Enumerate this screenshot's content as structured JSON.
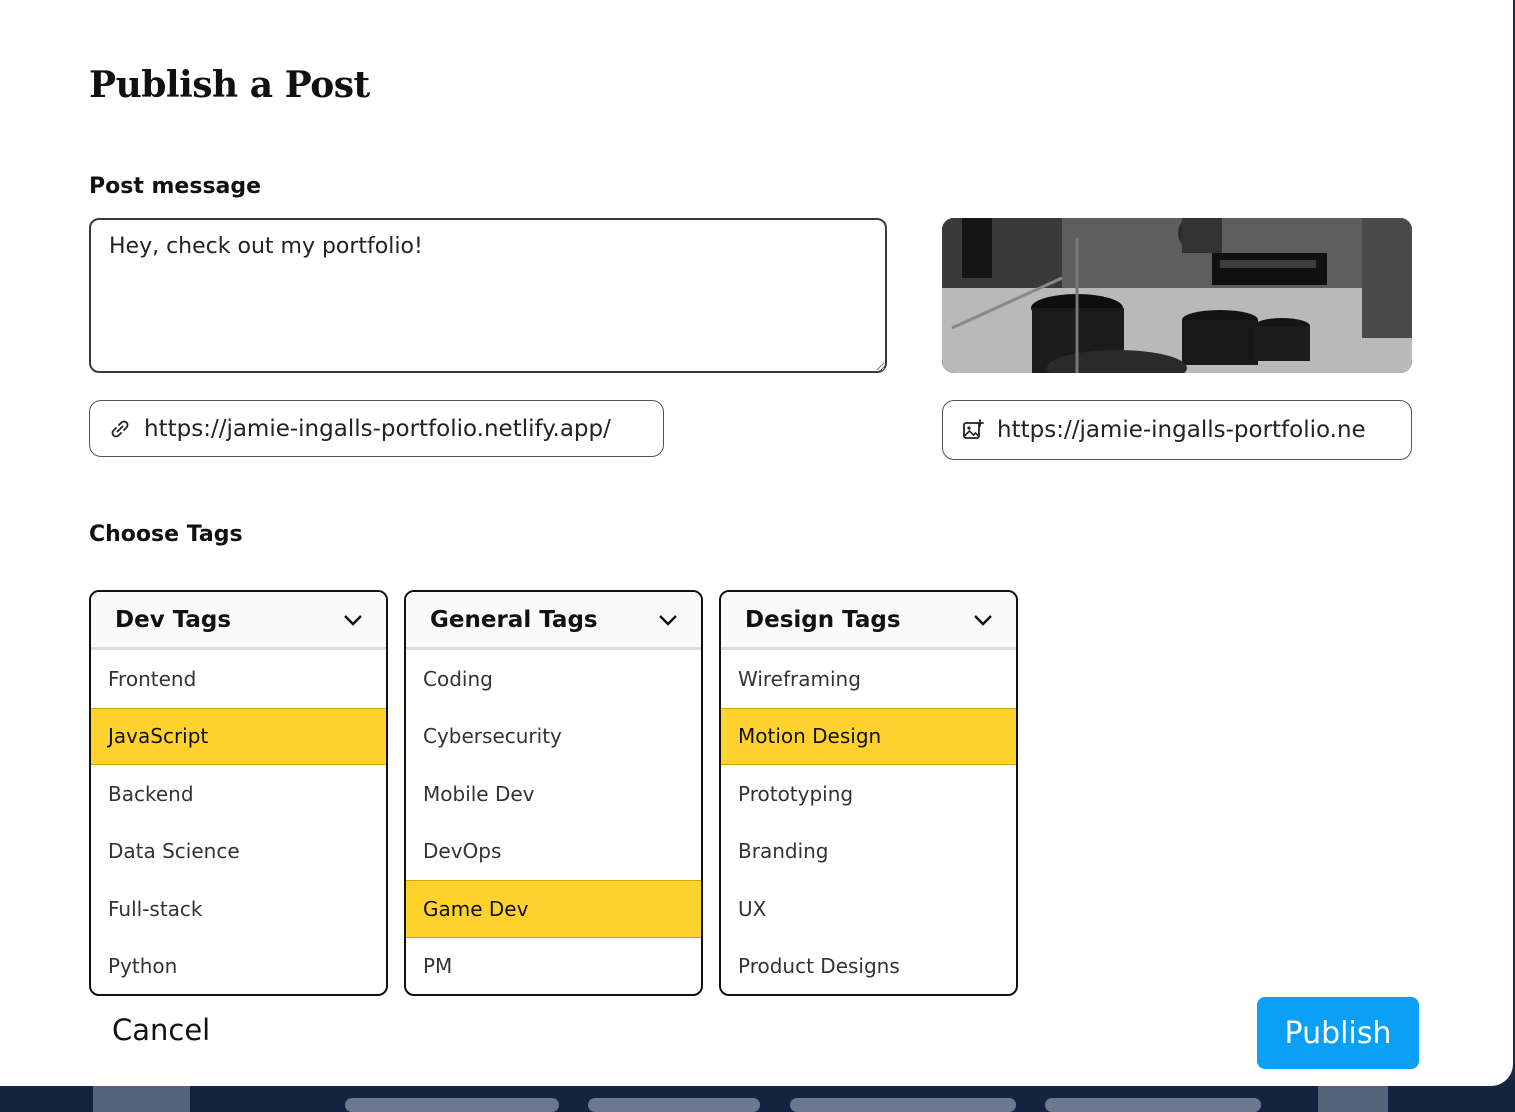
{
  "modal": {
    "title": "Publish a Post",
    "post_message_label": "Post message",
    "post_message_value": "Hey, check out my portfolio!",
    "link_url": "https://jamie-ingalls-portfolio.netlify.app/",
    "image_url": "https://jamie-ingalls-portfolio.ne",
    "choose_tags_label": "Choose Tags"
  },
  "tags": {
    "dev": {
      "label": "Dev Tags",
      "items": [
        "Frontend",
        "JavaScript",
        "Backend",
        "Data Science",
        "Full-stack",
        "Python"
      ],
      "selected": "JavaScript"
    },
    "general": {
      "label": "General Tags",
      "items": [
        "Coding",
        "Cybersecurity",
        "Mobile Dev",
        "DevOps",
        "Game Dev",
        "PM"
      ],
      "selected": "Game Dev"
    },
    "design": {
      "label": "Design Tags",
      "items": [
        "Wireframing",
        "Motion Design",
        "Prototyping",
        "Branding",
        "UX",
        "Product Designs"
      ],
      "selected": "Motion Design"
    }
  },
  "actions": {
    "cancel_label": "Cancel",
    "publish_label": "Publish"
  },
  "colors": {
    "selected_tag": "#ffd22e",
    "publish_button": "#0aa0f5",
    "backdrop": "#1b2a44"
  },
  "icons": {
    "link": "link-icon",
    "image": "image-add-icon",
    "chevron": "chevron-down-icon"
  }
}
